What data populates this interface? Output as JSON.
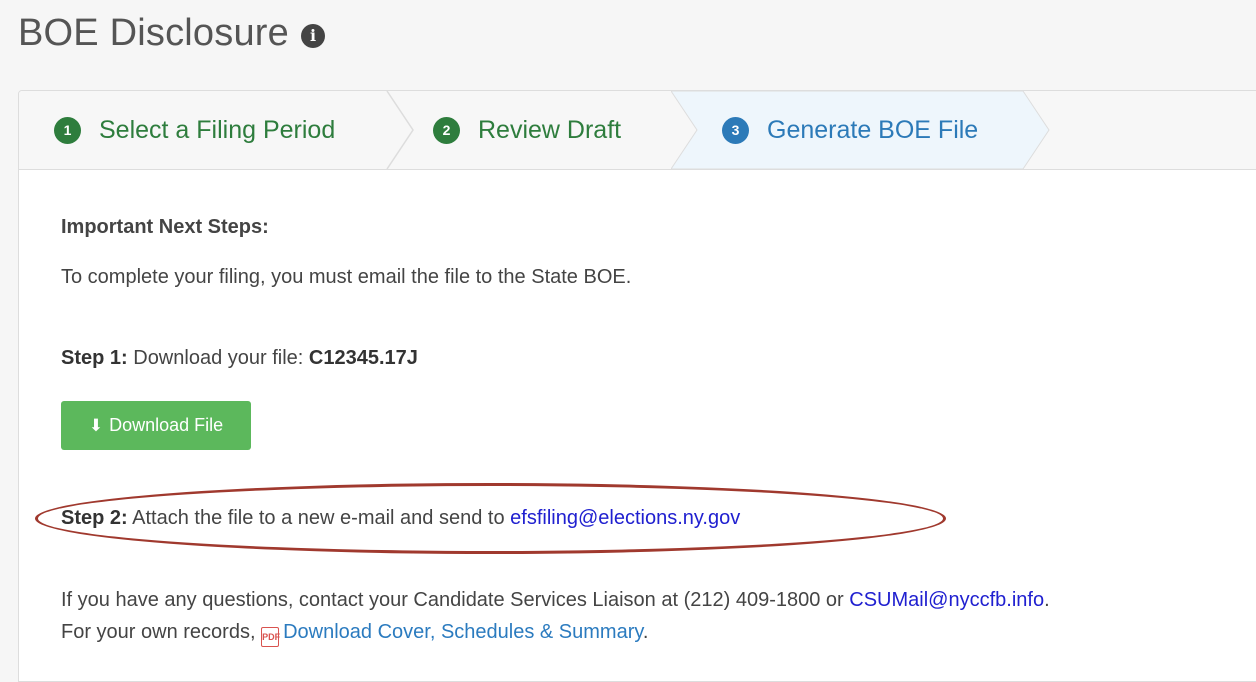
{
  "header": {
    "title": "BOE Disclosure",
    "info_icon": "i"
  },
  "wizard": {
    "steps": [
      {
        "number": "1",
        "label": "Select a Filing Period",
        "state": "done"
      },
      {
        "number": "2",
        "label": "Review Draft",
        "state": "done"
      },
      {
        "number": "3",
        "label": "Generate BOE File",
        "state": "active"
      }
    ]
  },
  "content": {
    "heading": "Important Next Steps:",
    "intro": "To complete your filing, you must email the file to the State BOE.",
    "step1": {
      "label": "Step 1:",
      "text": " Download your file: ",
      "filename": "C12345.17J"
    },
    "download_button": {
      "label": "Download File",
      "icon": "download-icon"
    },
    "step2": {
      "label": "Step 2:",
      "text": " Attach the file to a new e-mail and send to ",
      "email": "efsfiling@elections.ny.gov"
    },
    "questions": {
      "text": "If you have any questions, contact your Candidate Services Liaison at (212) 409-1800 or ",
      "email": "CSUMail@nyccfb.info",
      "end": "."
    },
    "records": {
      "text": "For your own records, ",
      "pdf_icon": "PDF",
      "link": "Download Cover, Schedules & Summary",
      "end": "."
    }
  },
  "colors": {
    "done": "#2e7d3d",
    "active": "#2c7ab8",
    "button": "#5cb85c",
    "highlight": "#a0392e"
  }
}
